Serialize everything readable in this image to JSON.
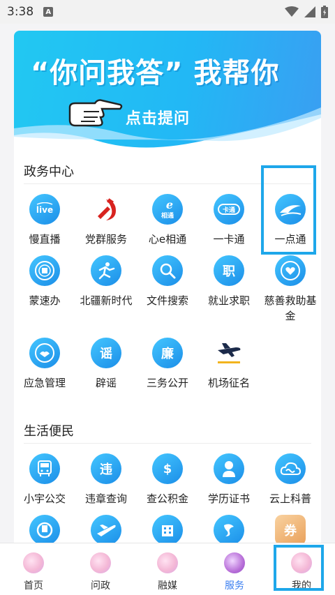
{
  "status_bar": {
    "time": "3:38",
    "notification_badge": "A"
  },
  "banner": {
    "title": "“你问我答” 我帮你",
    "cta": "点击提问"
  },
  "gov_section": {
    "title": "政务中心",
    "items": [
      {
        "label": "慢直播",
        "icon": "live-icon",
        "glyph": "live"
      },
      {
        "label": "党群服务",
        "icon": "party-emblem-icon",
        "glyph": ""
      },
      {
        "label": "心e相通",
        "icon": "xin-e-icon",
        "glyph": "e"
      },
      {
        "label": "一卡通",
        "icon": "card-icon",
        "glyph": "卡"
      },
      {
        "label": "一点通",
        "icon": "bird-icon",
        "glyph": ""
      },
      {
        "label": "蒙速办",
        "icon": "seal-icon",
        "glyph": ""
      },
      {
        "label": "北疆新时代",
        "icon": "runner-icon",
        "glyph": "文"
      },
      {
        "label": "文件搜索",
        "icon": "search-icon",
        "glyph": ""
      },
      {
        "label": "就业求职",
        "icon": "job-icon",
        "glyph": "职"
      },
      {
        "label": "慈善救助基金",
        "icon": "charity-icon",
        "glyph": ""
      },
      {
        "label": "应急管理",
        "icon": "emergency-icon",
        "glyph": ""
      },
      {
        "label": "辟谣",
        "icon": "rumor-icon",
        "glyph": "谣"
      },
      {
        "label": "三务公开",
        "icon": "public-icon",
        "glyph": "廉"
      },
      {
        "label": "机场征名",
        "icon": "plane-icon",
        "glyph": ""
      }
    ]
  },
  "life_section": {
    "title": "生活便民",
    "items": [
      {
        "label": "小宇公交",
        "icon": "bus-icon",
        "glyph": ""
      },
      {
        "label": "违章查询",
        "icon": "violation-icon",
        "glyph": "违"
      },
      {
        "label": "查公积金",
        "icon": "fund-icon",
        "glyph": "$"
      },
      {
        "label": "学历证书",
        "icon": "certificate-icon",
        "glyph": ""
      },
      {
        "label": "云上科普",
        "icon": "cloud-icon",
        "glyph": ""
      },
      {
        "label": "",
        "icon": "train-icon",
        "glyph": ""
      },
      {
        "label": "",
        "icon": "airplane-icon",
        "glyph": ""
      },
      {
        "label": "",
        "icon": "building-icon",
        "glyph": ""
      },
      {
        "label": "",
        "icon": "dance-icon",
        "glyph": ""
      },
      {
        "label": "",
        "icon": "ticket-icon",
        "glyph": "券"
      }
    ]
  },
  "bottom_nav": [
    {
      "label": "首页",
      "icon": "home-tab-icon",
      "active": false
    },
    {
      "label": "问政",
      "icon": "ask-tab-icon",
      "active": false
    },
    {
      "label": "融媒",
      "icon": "media-tab-icon",
      "active": false
    },
    {
      "label": "服务",
      "icon": "service-tab-icon",
      "active": true
    },
    {
      "label": "我的",
      "icon": "mine-tab-icon",
      "active": false
    }
  ],
  "colors": {
    "accent": "#1ea7ea",
    "icon_blue": "#2a9cf0",
    "active_tab": "#3a7ef0"
  }
}
